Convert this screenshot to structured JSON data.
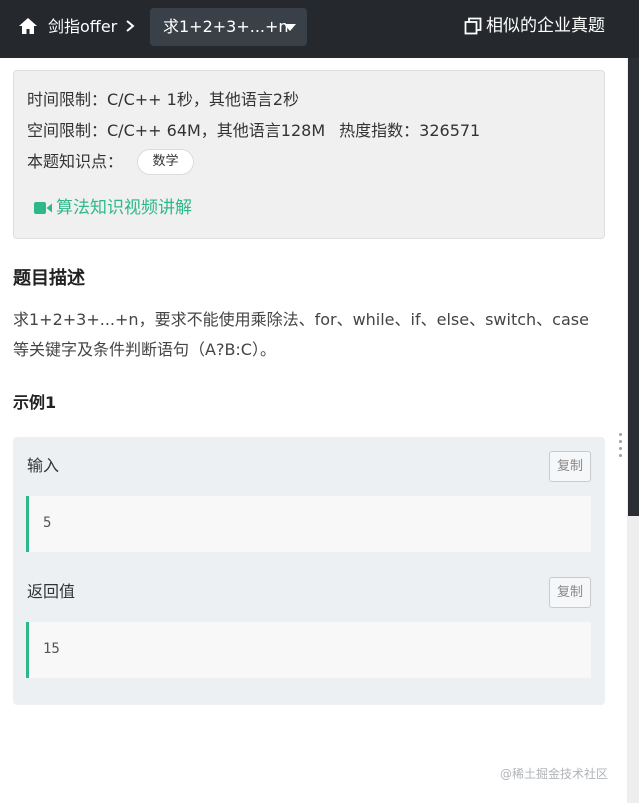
{
  "nav": {
    "breadcrumb": "剑指offer",
    "problem_selector": "求1+2+3+...+n",
    "similar_questions": "相似的企业真题"
  },
  "info": {
    "time_limit": "时间限制：C/C++ 1秒，其他语言2秒",
    "space_limit": "空间限制：C/C++ 64M，其他语言128M",
    "heat_index": "热度指数：326571",
    "knowledge_label": "本题知识点：",
    "knowledge_tag": "数学",
    "video_link": "算法知识视频讲解"
  },
  "description": {
    "title": "题目描述",
    "line1": "求1+2+3+...+n，要求不能使用乘除法、for、while、if、else、switch、case",
    "line2": "等关键字及条件判断语句（A?B:C）。"
  },
  "example": {
    "title": "示例1",
    "input_label": "输入",
    "input_value": "5",
    "output_label": "返回值",
    "output_value": "15",
    "copy_label": "复制"
  },
  "watermark": "@稀土掘金技术社区",
  "colors": {
    "topbar": "#25292e",
    "accent_green": "#2eb88a",
    "info_bg": "#f0f0f0",
    "example_bg": "#edf0f3"
  }
}
